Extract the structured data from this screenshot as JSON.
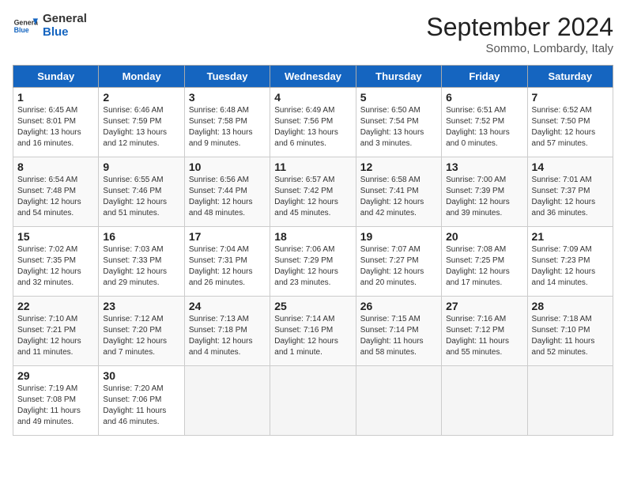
{
  "header": {
    "logo_general": "General",
    "logo_blue": "Blue",
    "title": "September 2024",
    "subtitle": "Sommo, Lombardy, Italy"
  },
  "days_of_week": [
    "Sunday",
    "Monday",
    "Tuesday",
    "Wednesday",
    "Thursday",
    "Friday",
    "Saturday"
  ],
  "weeks": [
    [
      {
        "day": "1",
        "lines": [
          "Sunrise: 6:45 AM",
          "Sunset: 8:01 PM",
          "Daylight: 13 hours",
          "and 16 minutes."
        ]
      },
      {
        "day": "2",
        "lines": [
          "Sunrise: 6:46 AM",
          "Sunset: 7:59 PM",
          "Daylight: 13 hours",
          "and 12 minutes."
        ]
      },
      {
        "day": "3",
        "lines": [
          "Sunrise: 6:48 AM",
          "Sunset: 7:58 PM",
          "Daylight: 13 hours",
          "and 9 minutes."
        ]
      },
      {
        "day": "4",
        "lines": [
          "Sunrise: 6:49 AM",
          "Sunset: 7:56 PM",
          "Daylight: 13 hours",
          "and 6 minutes."
        ]
      },
      {
        "day": "5",
        "lines": [
          "Sunrise: 6:50 AM",
          "Sunset: 7:54 PM",
          "Daylight: 13 hours",
          "and 3 minutes."
        ]
      },
      {
        "day": "6",
        "lines": [
          "Sunrise: 6:51 AM",
          "Sunset: 7:52 PM",
          "Daylight: 13 hours",
          "and 0 minutes."
        ]
      },
      {
        "day": "7",
        "lines": [
          "Sunrise: 6:52 AM",
          "Sunset: 7:50 PM",
          "Daylight: 12 hours",
          "and 57 minutes."
        ]
      }
    ],
    [
      {
        "day": "8",
        "lines": [
          "Sunrise: 6:54 AM",
          "Sunset: 7:48 PM",
          "Daylight: 12 hours",
          "and 54 minutes."
        ]
      },
      {
        "day": "9",
        "lines": [
          "Sunrise: 6:55 AM",
          "Sunset: 7:46 PM",
          "Daylight: 12 hours",
          "and 51 minutes."
        ]
      },
      {
        "day": "10",
        "lines": [
          "Sunrise: 6:56 AM",
          "Sunset: 7:44 PM",
          "Daylight: 12 hours",
          "and 48 minutes."
        ]
      },
      {
        "day": "11",
        "lines": [
          "Sunrise: 6:57 AM",
          "Sunset: 7:42 PM",
          "Daylight: 12 hours",
          "and 45 minutes."
        ]
      },
      {
        "day": "12",
        "lines": [
          "Sunrise: 6:58 AM",
          "Sunset: 7:41 PM",
          "Daylight: 12 hours",
          "and 42 minutes."
        ]
      },
      {
        "day": "13",
        "lines": [
          "Sunrise: 7:00 AM",
          "Sunset: 7:39 PM",
          "Daylight: 12 hours",
          "and 39 minutes."
        ]
      },
      {
        "day": "14",
        "lines": [
          "Sunrise: 7:01 AM",
          "Sunset: 7:37 PM",
          "Daylight: 12 hours",
          "and 36 minutes."
        ]
      }
    ],
    [
      {
        "day": "15",
        "lines": [
          "Sunrise: 7:02 AM",
          "Sunset: 7:35 PM",
          "Daylight: 12 hours",
          "and 32 minutes."
        ]
      },
      {
        "day": "16",
        "lines": [
          "Sunrise: 7:03 AM",
          "Sunset: 7:33 PM",
          "Daylight: 12 hours",
          "and 29 minutes."
        ]
      },
      {
        "day": "17",
        "lines": [
          "Sunrise: 7:04 AM",
          "Sunset: 7:31 PM",
          "Daylight: 12 hours",
          "and 26 minutes."
        ]
      },
      {
        "day": "18",
        "lines": [
          "Sunrise: 7:06 AM",
          "Sunset: 7:29 PM",
          "Daylight: 12 hours",
          "and 23 minutes."
        ]
      },
      {
        "day": "19",
        "lines": [
          "Sunrise: 7:07 AM",
          "Sunset: 7:27 PM",
          "Daylight: 12 hours",
          "and 20 minutes."
        ]
      },
      {
        "day": "20",
        "lines": [
          "Sunrise: 7:08 AM",
          "Sunset: 7:25 PM",
          "Daylight: 12 hours",
          "and 17 minutes."
        ]
      },
      {
        "day": "21",
        "lines": [
          "Sunrise: 7:09 AM",
          "Sunset: 7:23 PM",
          "Daylight: 12 hours",
          "and 14 minutes."
        ]
      }
    ],
    [
      {
        "day": "22",
        "lines": [
          "Sunrise: 7:10 AM",
          "Sunset: 7:21 PM",
          "Daylight: 12 hours",
          "and 11 minutes."
        ]
      },
      {
        "day": "23",
        "lines": [
          "Sunrise: 7:12 AM",
          "Sunset: 7:20 PM",
          "Daylight: 12 hours",
          "and 7 minutes."
        ]
      },
      {
        "day": "24",
        "lines": [
          "Sunrise: 7:13 AM",
          "Sunset: 7:18 PM",
          "Daylight: 12 hours",
          "and 4 minutes."
        ]
      },
      {
        "day": "25",
        "lines": [
          "Sunrise: 7:14 AM",
          "Sunset: 7:16 PM",
          "Daylight: 12 hours",
          "and 1 minute."
        ]
      },
      {
        "day": "26",
        "lines": [
          "Sunrise: 7:15 AM",
          "Sunset: 7:14 PM",
          "Daylight: 11 hours",
          "and 58 minutes."
        ]
      },
      {
        "day": "27",
        "lines": [
          "Sunrise: 7:16 AM",
          "Sunset: 7:12 PM",
          "Daylight: 11 hours",
          "and 55 minutes."
        ]
      },
      {
        "day": "28",
        "lines": [
          "Sunrise: 7:18 AM",
          "Sunset: 7:10 PM",
          "Daylight: 11 hours",
          "and 52 minutes."
        ]
      }
    ],
    [
      {
        "day": "29",
        "lines": [
          "Sunrise: 7:19 AM",
          "Sunset: 7:08 PM",
          "Daylight: 11 hours",
          "and 49 minutes."
        ]
      },
      {
        "day": "30",
        "lines": [
          "Sunrise: 7:20 AM",
          "Sunset: 7:06 PM",
          "Daylight: 11 hours",
          "and 46 minutes."
        ]
      },
      {
        "day": "",
        "lines": []
      },
      {
        "day": "",
        "lines": []
      },
      {
        "day": "",
        "lines": []
      },
      {
        "day": "",
        "lines": []
      },
      {
        "day": "",
        "lines": []
      }
    ]
  ]
}
